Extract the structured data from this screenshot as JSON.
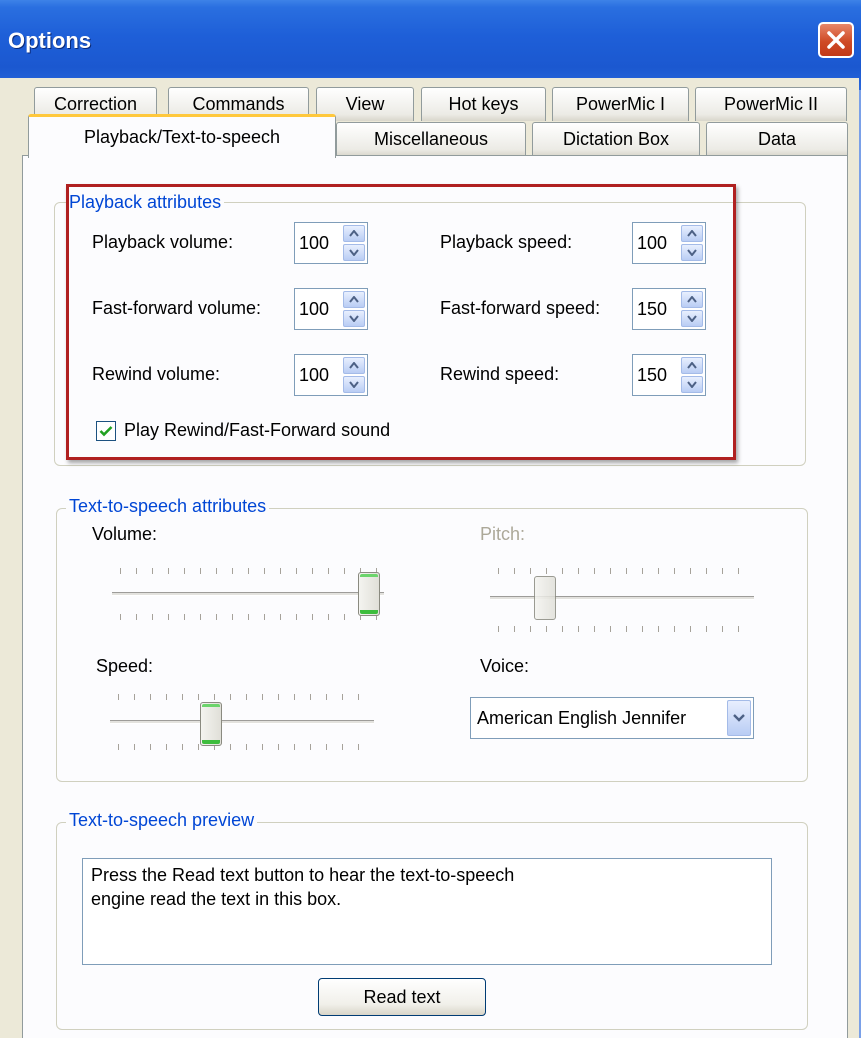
{
  "window": {
    "title": "Options"
  },
  "tabs": {
    "row1": [
      "Correction",
      "Commands",
      "View",
      "Hot keys",
      "PowerMic I",
      "PowerMic II"
    ],
    "row2": [
      "Playback/Text-to-speech",
      "Miscellaneous",
      "Dictation Box",
      "Data"
    ],
    "active": "Playback/Text-to-speech"
  },
  "playback": {
    "title": "Playback attributes",
    "playback_volume": {
      "label": "Playback volume:",
      "value": "100"
    },
    "fastforward_volume": {
      "label": "Fast-forward volume:",
      "value": "100"
    },
    "rewind_volume": {
      "label": "Rewind volume:",
      "value": "100"
    },
    "playback_speed": {
      "label": "Playback speed:",
      "value": "100"
    },
    "fastforward_speed": {
      "label": "Fast-forward speed:",
      "value": "150"
    },
    "rewind_speed": {
      "label": "Rewind speed:",
      "value": "150"
    },
    "sound_checkbox": {
      "label": "Play Rewind/Fast-Forward sound",
      "checked": true
    }
  },
  "tts": {
    "title": "Text-to-speech attributes",
    "volume": {
      "label": "Volume:",
      "level": 1.0
    },
    "pitch": {
      "label": "Pitch:",
      "level": 0.2,
      "disabled": true
    },
    "speed": {
      "label": "Speed:",
      "level": 0.4
    },
    "voice": {
      "label": "Voice:",
      "value": "American English Jennifer"
    }
  },
  "preview": {
    "title": "Text-to-speech preview",
    "text_line1": "Press the Read text button to hear the text-to-speech",
    "text_line2": "engine read the text in this box.",
    "button_label": "Read text"
  },
  "colors": {
    "titlebar": "#1b58d0",
    "group_title": "#0046d5",
    "highlight_frame": "#b02020",
    "active_tab_accent": "#ffc83c"
  }
}
